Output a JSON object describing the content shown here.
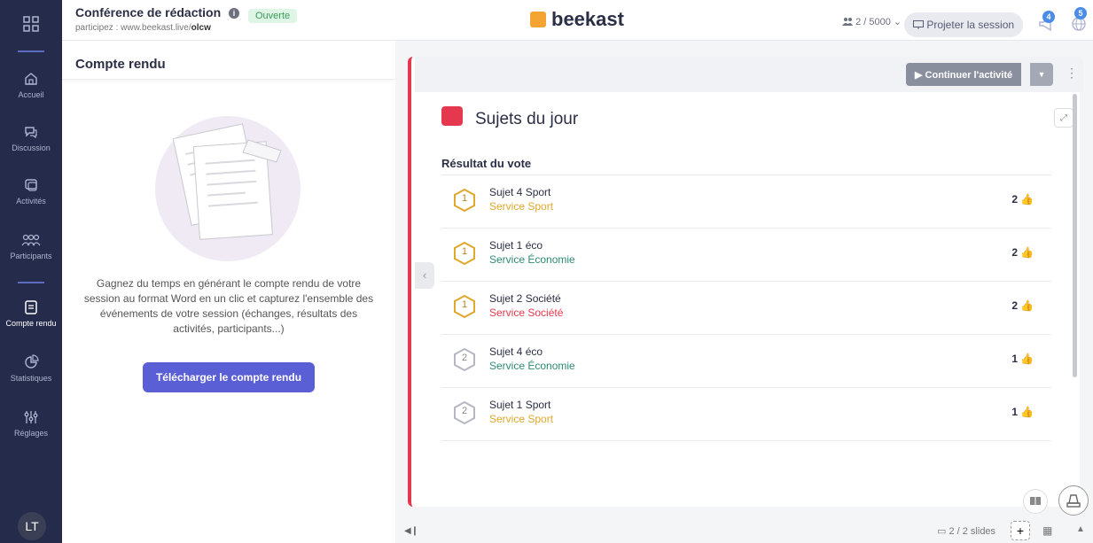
{
  "sidebar": {
    "items": [
      {
        "label": "Accueil",
        "icon": "home-icon",
        "active": false
      },
      {
        "label": "Discussion",
        "icon": "chat-icon",
        "active": false
      },
      {
        "label": "Activités",
        "icon": "activities-icon",
        "active": false
      },
      {
        "label": "Participants",
        "icon": "participants-icon",
        "active": false
      },
      {
        "label": "Compte rendu",
        "icon": "report-icon",
        "active": true
      },
      {
        "label": "Statistiques",
        "icon": "pie-chart-icon",
        "active": false
      },
      {
        "label": "Réglages",
        "icon": "settings-icon",
        "active": false
      }
    ],
    "avatar": "LT"
  },
  "header": {
    "title": "Conférence de rédaction",
    "status": "Ouverte",
    "url_prefix": "participez : www.beekast.live/",
    "url_code": "olcw",
    "brand": "beekast",
    "participants": "2 / 5000",
    "project_label": "Projeter la session",
    "notif_megaphone": "4",
    "notif_globe": "5"
  },
  "report": {
    "title": "Compte rendu",
    "description": "Gagnez du temps en générant le compte rendu de votre session au format Word en un clic et capturez l'ensemble des événements de votre session (échanges, résultats des activités, participants...)",
    "download_label": "Télécharger le compte rendu"
  },
  "activity": {
    "continue_label": "Continuer l'activité",
    "title": "Sujets du jour",
    "results_title": "Résultat du vote",
    "votes": [
      {
        "rank": "1",
        "name": "Sujet 4 Sport",
        "service": "Service Sport",
        "service_color": "#e0a72d",
        "count": "2",
        "gold": true
      },
      {
        "rank": "1",
        "name": "Sujet 1 éco",
        "service": "Service Économie",
        "service_color": "#2e8b72",
        "count": "2",
        "gold": true
      },
      {
        "rank": "1",
        "name": "Sujet 2 Société",
        "service": "Service Société",
        "service_color": "#e5384e",
        "count": "2",
        "gold": true
      },
      {
        "rank": "2",
        "name": "Sujet 4 éco",
        "service": "Service Économie",
        "service_color": "#2e8b72",
        "count": "1",
        "gold": false
      },
      {
        "rank": "2",
        "name": "Sujet 1 Sport",
        "service": "Service Sport",
        "service_color": "#e0a72d",
        "count": "1",
        "gold": false
      }
    ]
  },
  "footer": {
    "slides": "2 / 2 slides"
  },
  "colors": {
    "sidebar_bg": "#252c4b",
    "accent": "#5b5fd6",
    "activity_red": "#e5384e",
    "brand_orange": "#f3a433"
  }
}
